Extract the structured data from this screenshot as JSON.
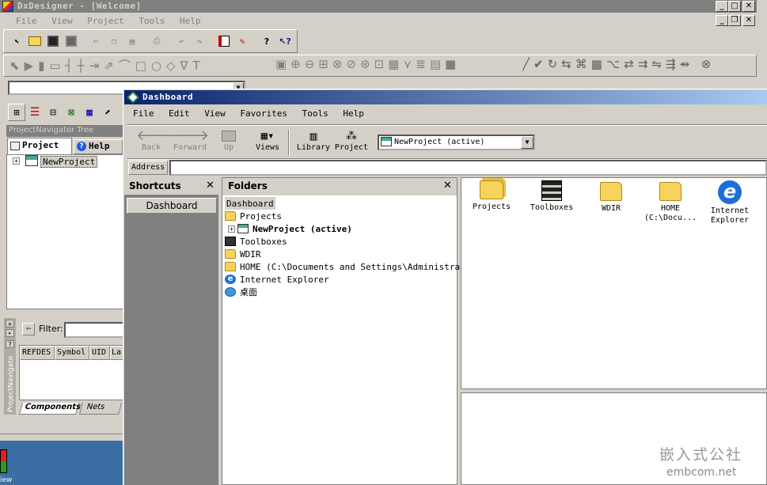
{
  "main_window": {
    "title": "DxDesigner - [Welcome]",
    "menu": [
      "File",
      "View",
      "Project",
      "Tools",
      "Help"
    ]
  },
  "navigator": {
    "header": "ProjectNavigator Tree",
    "tab_project": "Project",
    "tab_help": "Help",
    "tree_item": "NewProject",
    "filter_label": "Filter:",
    "columns": [
      "REFDES",
      "Symbol",
      "UID",
      "La"
    ],
    "tab_components": "Components",
    "tab_nets": "Nets",
    "side_label": "ProjectNavigato"
  },
  "dashboard": {
    "title": "Dashboard",
    "menu": [
      "File",
      "Edit",
      "View",
      "Favorites",
      "Tools",
      "Help"
    ],
    "toolbar": {
      "back": "Back",
      "forward": "Forward",
      "up": "Up",
      "views": "Views",
      "library": "Library",
      "project": "Project",
      "active_project": "NewProject (active)"
    },
    "address_label": "Address",
    "shortcuts": {
      "title": "Shortcuts",
      "button": "Dashboard"
    },
    "folders": {
      "title": "Folders",
      "root": "Dashboard",
      "items": [
        "Projects",
        "NewProject (active)",
        "Toolboxes",
        "WDIR",
        "HOME (C:\\Documents and Settings\\Administrator",
        "Internet Explorer",
        "桌面"
      ]
    },
    "icons": [
      {
        "line1": "Projects",
        "line2": ""
      },
      {
        "line1": "Toolboxes",
        "line2": ""
      },
      {
        "line1": "WDIR",
        "line2": ""
      },
      {
        "line1": "HOME",
        "line2": "(C:\\Docu..."
      },
      {
        "line1": "Internet",
        "line2": "Explorer"
      }
    ]
  },
  "desktop": {
    "label": "iew"
  },
  "watermark": {
    "line1": "嵌入式公社",
    "line2": "embcom.net"
  },
  "colors": {
    "titlebar_inactive": "#808080",
    "titlebar_active_start": "#0a246a",
    "titlebar_active_end": "#a6caf0",
    "face": "#d4d0c8",
    "ie_blue": "#1c6fd8"
  }
}
